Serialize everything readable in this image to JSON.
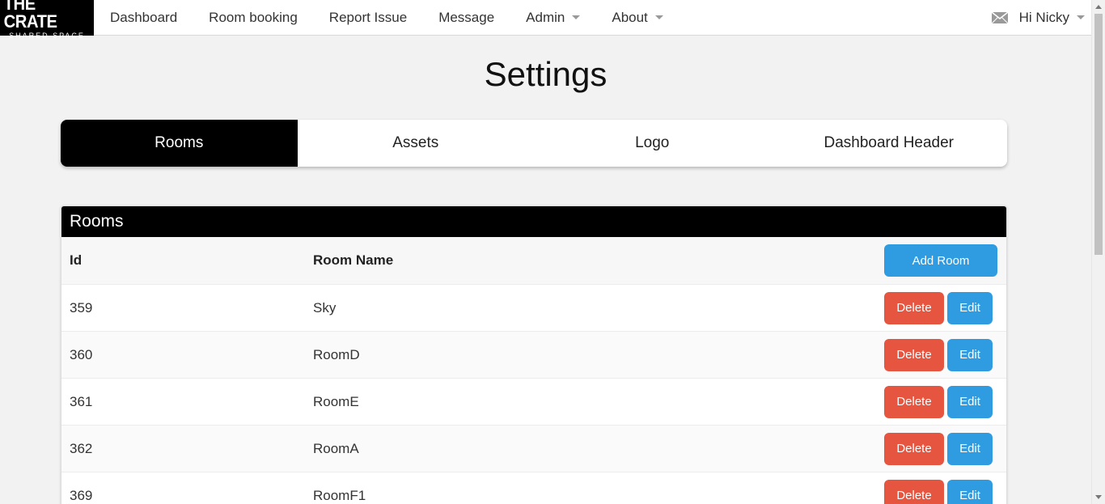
{
  "brand": {
    "line1": "THE CRATE",
    "line2": "SHARED SPACE"
  },
  "nav": {
    "items": [
      {
        "label": "Dashboard",
        "dropdown": false
      },
      {
        "label": "Room booking",
        "dropdown": false
      },
      {
        "label": "Report Issue",
        "dropdown": false
      },
      {
        "label": "Message",
        "dropdown": false
      },
      {
        "label": "Admin",
        "dropdown": true
      },
      {
        "label": "About",
        "dropdown": true
      }
    ],
    "user_greeting": "Hi Nicky",
    "mail_icon": "envelope-icon"
  },
  "page": {
    "title": "Settings"
  },
  "tabs": [
    {
      "label": "Rooms",
      "active": true
    },
    {
      "label": "Assets",
      "active": false
    },
    {
      "label": "Logo",
      "active": false
    },
    {
      "label": "Dashboard Header",
      "active": false
    }
  ],
  "rooms_panel": {
    "title": "Rooms",
    "columns": {
      "id": "Id",
      "name": "Room Name"
    },
    "add_label": "Add Room",
    "delete_label": "Delete",
    "edit_label": "Edit",
    "rows": [
      {
        "id": "359",
        "name": "Sky"
      },
      {
        "id": "360",
        "name": "RoomD"
      },
      {
        "id": "361",
        "name": "RoomE"
      },
      {
        "id": "362",
        "name": "RoomA"
      },
      {
        "id": "369",
        "name": "RoomF1"
      }
    ]
  },
  "colors": {
    "accent": "#2f9be0",
    "danger": "#e65540",
    "header": "#000000"
  }
}
